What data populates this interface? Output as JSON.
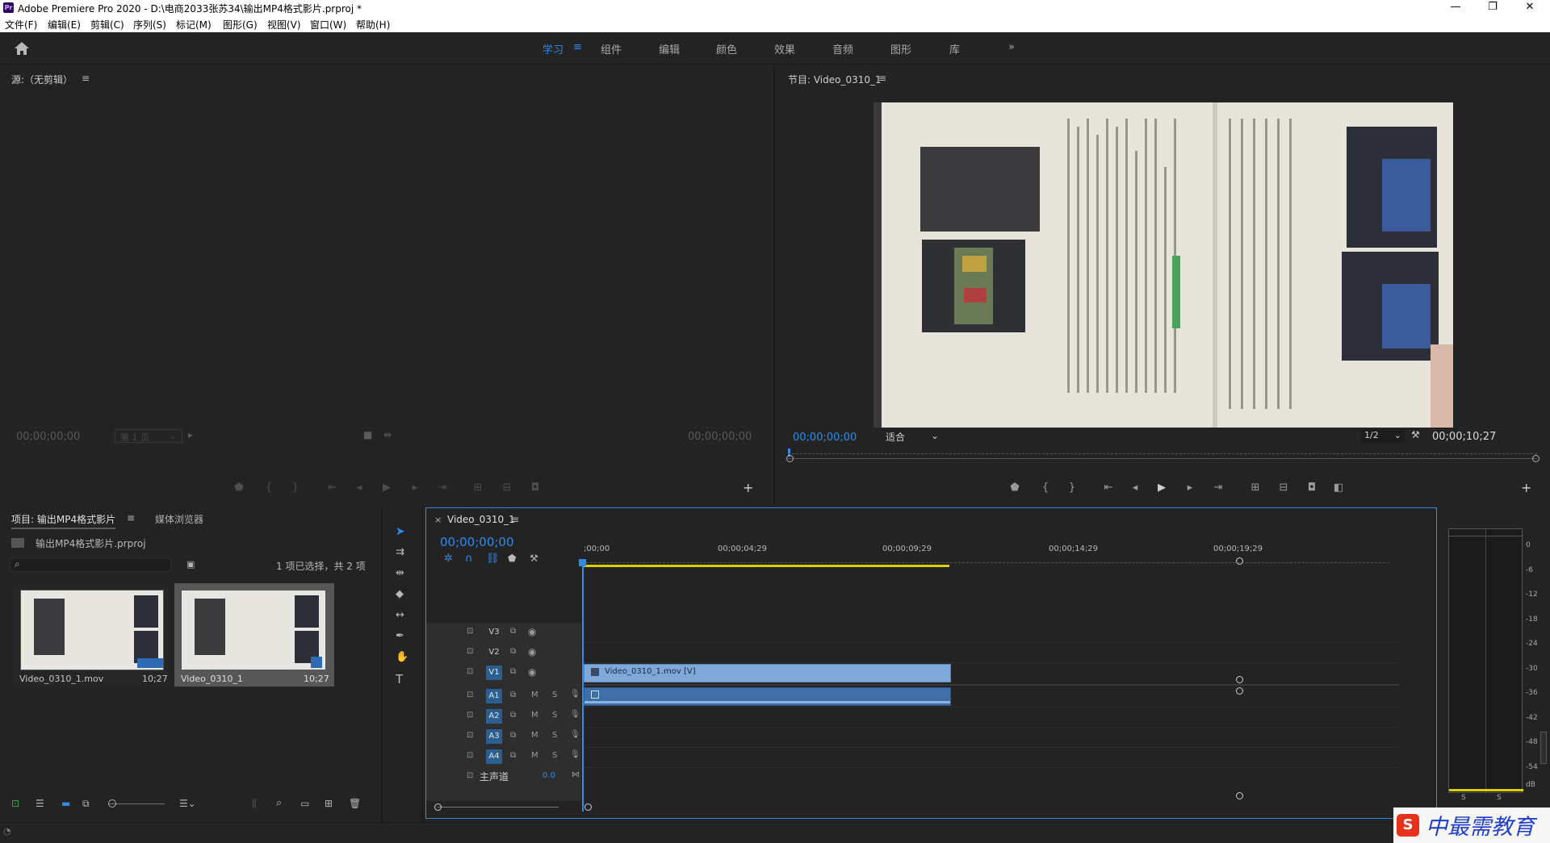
{
  "window": {
    "app_icon": "Pr",
    "title": "Adobe Premiere Pro 2020 - D:\\电商2033张苏34\\输出MP4格式影片.prproj *",
    "minimize": "—",
    "restore": "❐",
    "close": "✕"
  },
  "menu": [
    "文件(F)",
    "编辑(E)",
    "剪辑(C)",
    "序列(S)",
    "标记(M)",
    "图形(G)",
    "视图(V)",
    "窗口(W)",
    "帮助(H)"
  ],
  "workspaces": {
    "items": [
      "学习",
      "组件",
      "编辑",
      "颜色",
      "效果",
      "音频",
      "图形",
      "库"
    ],
    "active": "学习",
    "more": "»"
  },
  "source_monitor": {
    "title": "源:（无剪辑）",
    "timecode_left": "00;00;00;00",
    "page_select": "第 1 页",
    "timecode_right": "00;00;00;00"
  },
  "program_monitor": {
    "title": "节目: Video_0310_1",
    "timecode_left": "00;00;00;00",
    "fit": "适合",
    "resolution": "1/2",
    "timecode_right": "00;00;10;27"
  },
  "project": {
    "tab_project": "项目: 输出MP4格式影片",
    "tab_media": "媒体浏览器",
    "file_name": "输出MP4格式影片.prproj",
    "selection_info": "1 项已选择，共 2 项",
    "items": [
      {
        "name": "Video_0310_1.mov",
        "duration": "10;27"
      },
      {
        "name": "Video_0310_1",
        "duration": "10;27"
      }
    ]
  },
  "timeline": {
    "tab": "Video_0310_1",
    "timecode": "00;00;00;00",
    "ruler": [
      ";00;00",
      "00;00;04;29",
      "00;00;09;29",
      "00;00;14;29",
      "00;00;19;29"
    ],
    "video_tracks": [
      "V3",
      "V2",
      "V1"
    ],
    "audio_tracks": [
      "A1",
      "A2",
      "A3",
      "A4"
    ],
    "master_label": "主声道",
    "master_value": "0.0",
    "mute": "M",
    "solo": "S",
    "clip_video": "Video_0310_1.mov [V]",
    "clip_progress": 0.45
  },
  "audio_meter": {
    "scale": [
      "0",
      "-6",
      "-12",
      "-18",
      "-24",
      "-30",
      "-36",
      "-42",
      "-48",
      "-54",
      "dB"
    ],
    "solo": [
      "S",
      "S"
    ]
  },
  "watermark": {
    "text": "中最需教育"
  },
  "colors": {
    "accent": "#2d8ceb",
    "clip_video": "#7fa8d9",
    "clip_audio": "#3f6fa6"
  }
}
